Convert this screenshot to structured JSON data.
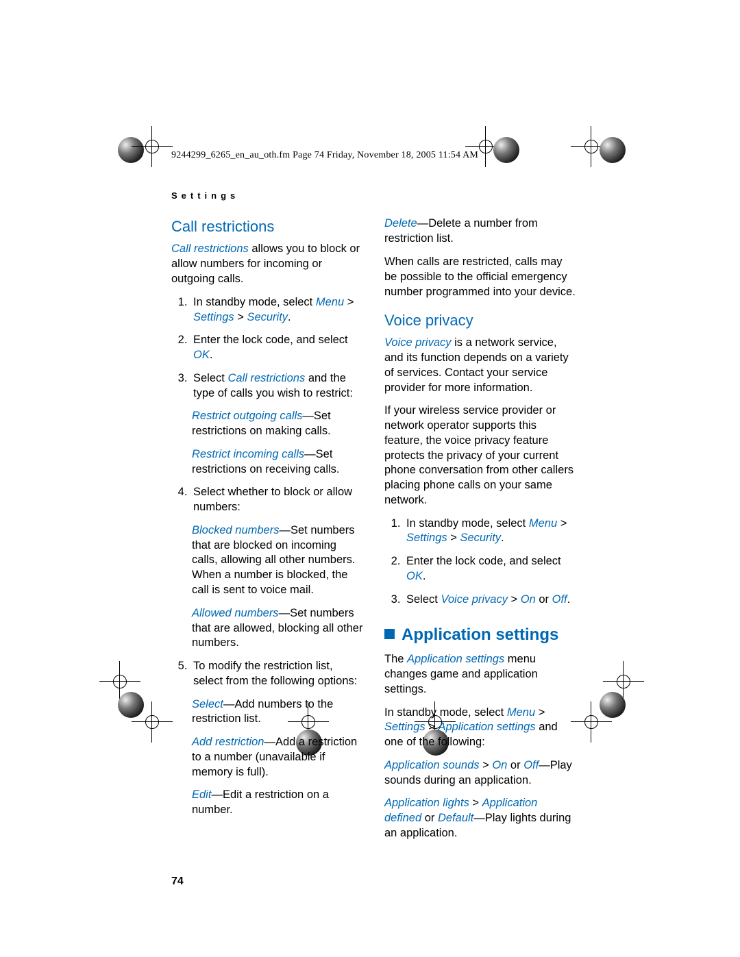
{
  "header": "9244299_6265_en_au_oth.fm  Page 74  Friday, November 18, 2005  11:54 AM",
  "section_label": "Settings",
  "page_number": "74",
  "left": {
    "h_call": "Call restrictions",
    "intro_b": "Call restrictions",
    "intro_rest": " allows you to block or allow numbers for incoming or outgoing calls.",
    "ol1_a": "In standby mode, select ",
    "ol1_b": "Menu",
    "ol1_c": " > ",
    "ol1_d": "Settings",
    "ol1_e": " > ",
    "ol1_f": "Security",
    "ol1_g": ".",
    "ol2_a": "Enter the lock code, and select ",
    "ol2_b": "OK",
    "ol2_c": ".",
    "ol3_a": "Select ",
    "ol3_b": "Call restrictions",
    "ol3_c": " and the type of calls you wish to restrict:",
    "p3a_b": "Restrict outgoing calls",
    "p3a_r": "—Set restrictions on making calls.",
    "p3b_b": "Restrict incoming calls",
    "p3b_r": "—Set restrictions on receiving calls.",
    "ol4": "Select whether to block or allow numbers:",
    "p4a_b": "Blocked numbers",
    "p4a_r": "—Set numbers that are blocked on incoming calls, allowing all other numbers. When a number is blocked, the call is sent to voice mail.",
    "p4b_b": "Allowed numbers",
    "p4b_r": "—Set numbers that are allowed, blocking all other numbers.",
    "ol5": "To modify the restriction list, select from the following options:",
    "p5a_b": "Select",
    "p5a_r": "—Add numbers to the restriction list.",
    "p5b_b": "Add restriction",
    "p5b_r": "—Add a restriction to a number (unavailable if memory is full).",
    "p5c_b": "Edit",
    "p5c_r": "—Edit a restriction on a number."
  },
  "right": {
    "p_del_b": "Delete",
    "p_del_r": "—Delete a number from restriction list.",
    "p_when": "When calls are restricted, calls may be possible to the official emergency number programmed into your device.",
    "h_voice": "Voice privacy",
    "vp_b": "Voice privacy",
    "vp_r": " is a network service, and its function depends on a variety of services. Contact your service provider for more information.",
    "vp2": "If your wireless service provider or network operator supports this feature, the voice privacy feature protects the privacy of your current phone conversation from other callers placing phone calls on your same network.",
    "vol1_a": "In standby mode, select ",
    "vol1_b": "Menu",
    "vol1_c": " > ",
    "vol1_d": "Settings",
    "vol1_e": " > ",
    "vol1_f": "Security",
    "vol1_g": ".",
    "vol2_a": "Enter the lock code, and select ",
    "vol2_b": "OK",
    "vol2_c": ".",
    "vol3_a": "Select ",
    "vol3_b": "Voice privacy",
    "vol3_c": " > ",
    "vol3_d": "On",
    "vol3_e": " or ",
    "vol3_f": "Off",
    "vol3_g": ".",
    "h_app": "Application settings",
    "ap_a": "The ",
    "ap_b": "Application settings",
    "ap_c": " menu changes game and application settings.",
    "ap2_a": "In standby mode, select ",
    "ap2_b": "Menu",
    "ap2_c": " > ",
    "ap2_d": "Settings",
    "ap2_e": " > ",
    "ap2_f": "Application settings",
    "ap2_g": " and one of the following:",
    "ap3_b": "Application sounds",
    "ap3_c": " > ",
    "ap3_d": "On",
    "ap3_e": " or ",
    "ap3_f": "Off",
    "ap3_g": "—Play sounds during an application.",
    "ap4_b": "Application lights",
    "ap4_c": " > ",
    "ap4_d": "Application defined",
    "ap4_e": " or ",
    "ap4_f": "Default",
    "ap4_g": "—Play lights during an application."
  }
}
